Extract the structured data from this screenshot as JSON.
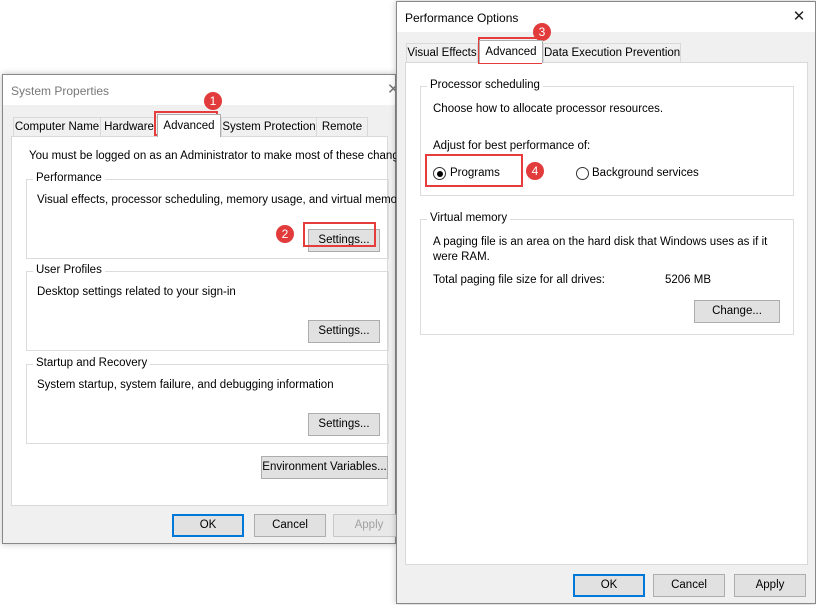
{
  "system_properties": {
    "title": "System Properties",
    "close_glyph": "✕",
    "tabs": [
      "Computer Name",
      "Hardware",
      "Advanced",
      "System Protection",
      "Remote"
    ],
    "active_tab": "Advanced",
    "admin_note": "You must be logged on as an Administrator to make most of these changes.",
    "performance": {
      "label": "Performance",
      "desc": "Visual effects, processor scheduling, memory usage, and virtual memory",
      "button": "Settings..."
    },
    "user_profiles": {
      "label": "User Profiles",
      "desc": "Desktop settings related to your sign-in",
      "button": "Settings..."
    },
    "startup_recovery": {
      "label": "Startup and Recovery",
      "desc": "System startup, system failure, and debugging information",
      "button": "Settings..."
    },
    "env_button": "Environment Variables...",
    "ok": "OK",
    "cancel": "Cancel",
    "apply": "Apply"
  },
  "performance_options": {
    "title": "Performance Options",
    "close_glyph": "✕",
    "tabs": [
      "Visual Effects",
      "Advanced",
      "Data Execution Prevention"
    ],
    "active_tab": "Advanced",
    "processor_scheduling": {
      "label": "Processor scheduling",
      "desc": "Choose how to allocate processor resources.",
      "adjust": "Adjust for best performance of:",
      "options": [
        "Programs",
        "Background services"
      ],
      "selected": "Programs"
    },
    "virtual_memory": {
      "label": "Virtual memory",
      "desc_line1": "A paging file is an area on the hard disk that Windows uses as if it",
      "desc_line2": "were RAM.",
      "total_label": "Total paging file size for all drives:",
      "total_value": "5206 MB",
      "button": "Change..."
    },
    "ok": "OK",
    "cancel": "Cancel",
    "apply": "Apply"
  },
  "annotations": {
    "step1": "1",
    "step2": "2",
    "step3": "3",
    "step4": "4"
  },
  "colors": {
    "highlight": "#e63c3c",
    "badge": "#e23b3b",
    "default_button_border": "#0078d7"
  }
}
